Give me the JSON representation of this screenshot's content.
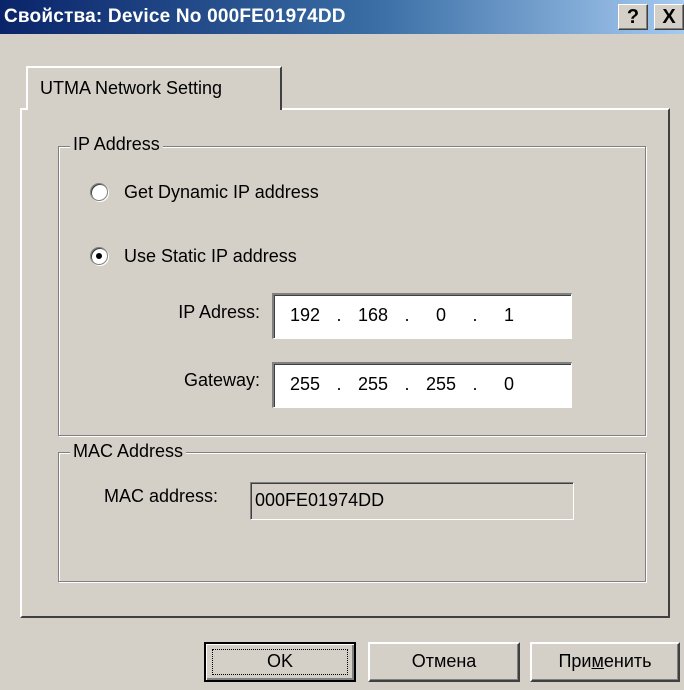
{
  "window": {
    "title": "Свойства: Device No  000FE01974DD",
    "help_label": "?",
    "close_label": "X"
  },
  "tabs": [
    {
      "label": "UTMA Network Setting",
      "selected": true
    }
  ],
  "ip_group": {
    "label": "IP Address",
    "dynamic_option": {
      "label": "Get Dynamic IP address",
      "checked": false
    },
    "static_option": {
      "label": "Use Static IP address",
      "checked": true
    },
    "ip_address": {
      "label": "IP Adress:",
      "octets": [
        "192",
        "168",
        "0",
        "1"
      ]
    },
    "gateway": {
      "label": "Gateway:",
      "octets": [
        "255",
        "255",
        "255",
        "0"
      ]
    }
  },
  "mac_group": {
    "label": "MAC Address",
    "field_label": "MAC address:",
    "value": "000FE01974DD"
  },
  "buttons": {
    "ok": "OK",
    "cancel": "Отмена",
    "apply_prefix": "При",
    "apply_mnemonic": "м",
    "apply_suffix": "енить"
  }
}
